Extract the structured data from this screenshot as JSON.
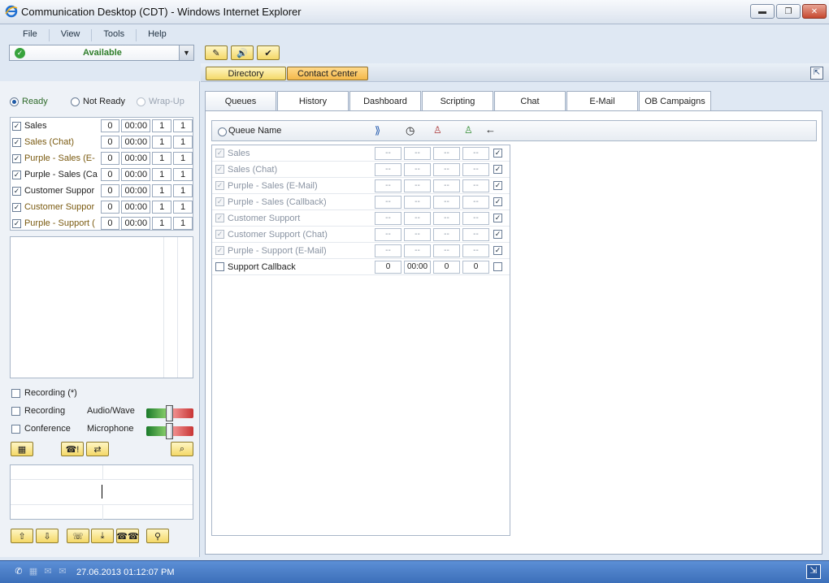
{
  "window": {
    "title": "Communication Desktop (CDT) - Windows Internet Explorer"
  },
  "menu": [
    "File",
    "View",
    "Tools",
    "Help"
  ],
  "status": {
    "selected": "Available"
  },
  "header_tabs": {
    "directory": "Directory",
    "contact_center": "Contact Center"
  },
  "agent_state": {
    "ready": "Ready",
    "not_ready": "Not Ready",
    "wrap_up": "Wrap-Up"
  },
  "left_queues": [
    {
      "name": "Sales",
      "c1": "0",
      "c2": "00:00",
      "c3": "1",
      "c4": "1",
      "color": "#222222"
    },
    {
      "name": "Sales (Chat)",
      "c1": "0",
      "c2": "00:00",
      "c3": "1",
      "c4": "1",
      "color": "#7a5a10"
    },
    {
      "name": "Purple - Sales (E-",
      "c1": "0",
      "c2": "00:00",
      "c3": "1",
      "c4": "1",
      "color": "#7a5a10"
    },
    {
      "name": "Purple - Sales (Ca",
      "c1": "0",
      "c2": "00:00",
      "c3": "1",
      "c4": "1",
      "color": "#222222"
    },
    {
      "name": "Customer Suppor",
      "c1": "0",
      "c2": "00:00",
      "c3": "1",
      "c4": "1",
      "color": "#222222"
    },
    {
      "name": "Customer Suppor",
      "c1": "0",
      "c2": "00:00",
      "c3": "1",
      "c4": "1",
      "color": "#7a5a10"
    },
    {
      "name": "Purple - Support (",
      "c1": "0",
      "c2": "00:00",
      "c3": "1",
      "c4": "1",
      "color": "#7a5a10"
    }
  ],
  "recording": {
    "rec_star": "Recording (*)",
    "rec": "Recording",
    "conference": "Conference",
    "audio": "Audio/Wave",
    "mic": "Microphone"
  },
  "main_tabs": [
    "Queues",
    "History",
    "Dashboard",
    "Scripting",
    "Chat",
    "E-Mail",
    "OB Campaigns"
  ],
  "queue_header": {
    "name": "Queue Name"
  },
  "queues": [
    {
      "name": "Sales",
      "v1": "--",
      "v2": "--",
      "v3": "--",
      "v4": "--",
      "enabled": false
    },
    {
      "name": "Sales (Chat)",
      "v1": "--",
      "v2": "--",
      "v3": "--",
      "v4": "--",
      "enabled": false
    },
    {
      "name": "Purple - Sales (E-Mail)",
      "v1": "--",
      "v2": "--",
      "v3": "--",
      "v4": "--",
      "enabled": false
    },
    {
      "name": "Purple - Sales (Callback)",
      "v1": "--",
      "v2": "--",
      "v3": "--",
      "v4": "--",
      "enabled": false
    },
    {
      "name": "Customer Support",
      "v1": "--",
      "v2": "--",
      "v3": "--",
      "v4": "--",
      "enabled": false
    },
    {
      "name": "Customer Support (Chat)",
      "v1": "--",
      "v2": "--",
      "v3": "--",
      "v4": "--",
      "enabled": false
    },
    {
      "name": "Purple - Support (E-Mail)",
      "v1": "--",
      "v2": "--",
      "v3": "--",
      "v4": "--",
      "enabled": false
    },
    {
      "name": "Support Callback",
      "v1": "0",
      "v2": "00:00",
      "v3": "0",
      "v4": "0",
      "enabled": true
    }
  ],
  "statusbar": {
    "datetime": "27.06.2013 01:12:07 PM"
  }
}
